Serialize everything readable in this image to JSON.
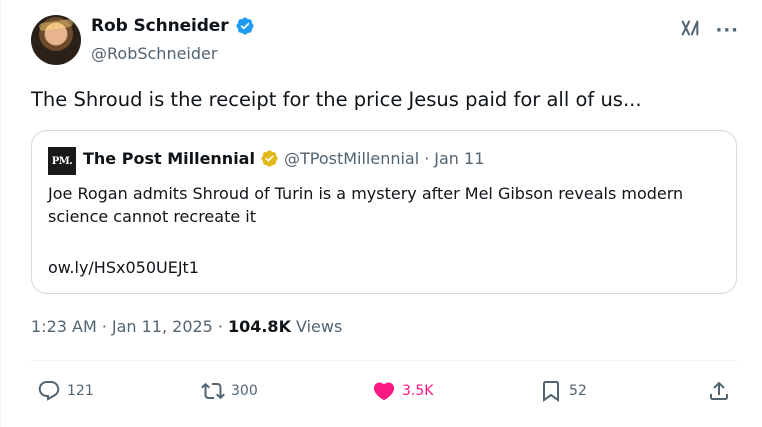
{
  "author": {
    "display_name": "Rob Schneider",
    "handle": "@RobSchneider"
  },
  "icons": {
    "verified": "verified-badge-icon",
    "grok": "grok-icon",
    "more": "more-icon",
    "more_glyph": "···",
    "grok_glyph": "x/"
  },
  "tweet": {
    "text": "The Shroud is the receipt for the price Jesus paid for all of us..."
  },
  "quote": {
    "logo_text": "PM.",
    "name": "The Post Millennial",
    "handle": "@TPostMillennial",
    "separator": "·",
    "date": "Jan 11",
    "body": "Joe Rogan admits Shroud of Turin is a mystery after Mel Gibson reveals modern science cannot recreate it",
    "link": "ow.ly/HSx050UEJt1"
  },
  "meta": {
    "time": "1:23 AM",
    "sep1": "·",
    "date": "Jan 11, 2025",
    "sep2": "·",
    "views_count": "104.8K",
    "views_label": "Views"
  },
  "actions": {
    "reply_count": "121",
    "repost_count": "300",
    "like_count": "3.5K",
    "bookmark_count": "52"
  },
  "colors": {
    "verified_blue": "#1d9bf0",
    "verified_gold": "#e2b719",
    "like_pink": "#f91880",
    "secondary_text": "#536471"
  }
}
